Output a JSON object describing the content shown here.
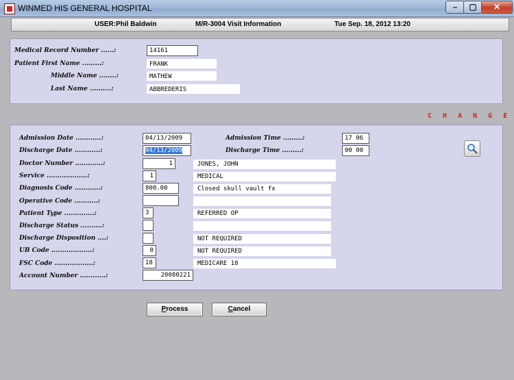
{
  "window": {
    "title": "WINMED HIS GENERAL HOSPITAL",
    "min": "–",
    "max": "▢",
    "close": "✕"
  },
  "header": {
    "user": "USER:Phil Baldwin",
    "screen": "M/R-3004  Visit Information",
    "datetime": "Tue Sep. 18, 2012 13:20"
  },
  "patient": {
    "mrn_label": "Medical Record Number ......:",
    "mrn": "14161",
    "first_label": "Patient First Name .........:",
    "first": "FRANK",
    "middle_label": "Middle Name ........:",
    "middle": "MATHEW",
    "last_label": "Last Name ..........:",
    "last": "ABBREDERIS"
  },
  "mode": "C H A N G E",
  "visit": {
    "admission_date_label": "Admission Date ............:",
    "admission_date": "04/13/2009",
    "admission_time_label": "Admission Time .........:",
    "admission_time": "17 06",
    "discharge_date_label": "Discharge Date ............:",
    "discharge_date": "04/13/2009",
    "discharge_time_label": "Discharge Time .........:",
    "discharge_time": "00 00",
    "doctor_label": "Doctor Number .............:",
    "doctor": "1",
    "doctor_desc": "JONES, JOHN",
    "service_label": "Service ...................:",
    "service": "1",
    "service_desc": "MEDICAL",
    "diagnosis_label": "Diagnosis Code ............:",
    "diagnosis": "800.00",
    "diagnosis_desc": "Closed skull vault fx",
    "operative_label": "Operative Code ...........:",
    "operative": "",
    "operative_desc": "",
    "patient_type_label": "Patient Type ..............:",
    "patient_type": "3",
    "patient_type_desc": "REFERRED OP",
    "discharge_status_label": "Discharge Status ..........:",
    "discharge_status": "",
    "discharge_status_desc": "",
    "discharge_disp_label": "Discharge Disposition ....:",
    "discharge_disp": "",
    "discharge_disp_desc": "NOT REQUIRED",
    "ub_label": "UB Code ...................:",
    "ub": "0",
    "ub_desc": "NOT REQUIRED",
    "fsc_label": "FSC Code ..................:",
    "fsc": "18",
    "fsc_desc": "MEDICARE 18",
    "account_label": "Account Number ............:",
    "account": "20080221"
  },
  "buttons": {
    "process_rest": "rocess",
    "process_key": "P",
    "cancel_rest": "ancel",
    "cancel_key": "C"
  },
  "icons": {
    "app": "app-icon",
    "search": "magnifier-icon"
  }
}
